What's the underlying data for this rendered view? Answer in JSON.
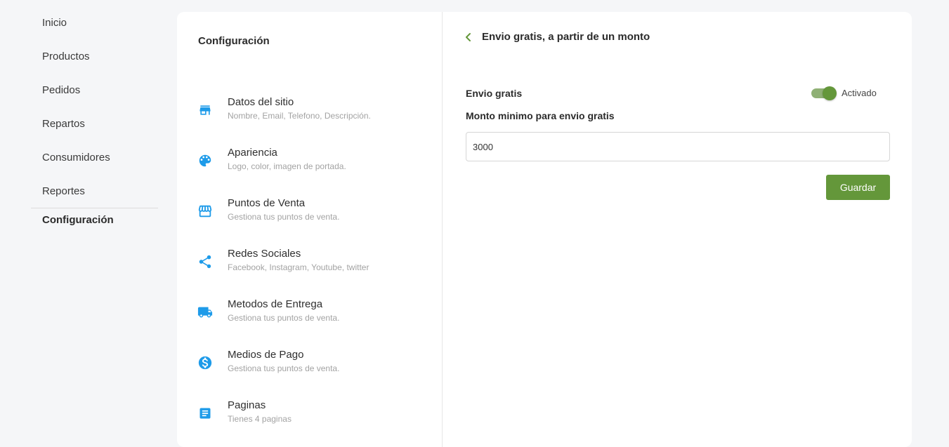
{
  "sidebar": {
    "items": [
      {
        "label": "Inicio"
      },
      {
        "label": "Productos"
      },
      {
        "label": "Pedidos"
      },
      {
        "label": "Repartos"
      },
      {
        "label": "Consumidores"
      },
      {
        "label": "Reportes"
      }
    ],
    "active": {
      "label": "Configuración"
    }
  },
  "settings": {
    "title": "Configuración",
    "items": [
      {
        "name": "Datos del sitio",
        "desc": "Nombre, Email, Telefono, Descripción.",
        "icon": "store-icon"
      },
      {
        "name": "Apariencia",
        "desc": "Logo, color, imagen de portada.",
        "icon": "palette-icon"
      },
      {
        "name": "Puntos de Venta",
        "desc": "Gestiona tus puntos de venta.",
        "icon": "storefront-icon"
      },
      {
        "name": "Redes Sociales",
        "desc": "Facebook, Instagram, Youtube, twitter",
        "icon": "share-icon"
      },
      {
        "name": "Metodos de Entrega",
        "desc": "Gestiona tus puntos de venta.",
        "icon": "truck-icon"
      },
      {
        "name": "Medios de Pago",
        "desc": "Gestiona tus puntos de venta.",
        "icon": "dollar-icon"
      },
      {
        "name": "Paginas",
        "desc": "Tienes 4 paginas",
        "icon": "document-icon"
      }
    ]
  },
  "panel": {
    "title": "Envio gratis, a partir de un monto",
    "envio_label": "Envio gratis",
    "toggle_state_label": "Activado",
    "toggle_on": true,
    "monto_label": "Monto minimo para envio gratis",
    "monto_value": "3000",
    "save_label": "Guardar"
  },
  "colors": {
    "accent": "#64973a",
    "icon_blue": "#1e9be9"
  }
}
